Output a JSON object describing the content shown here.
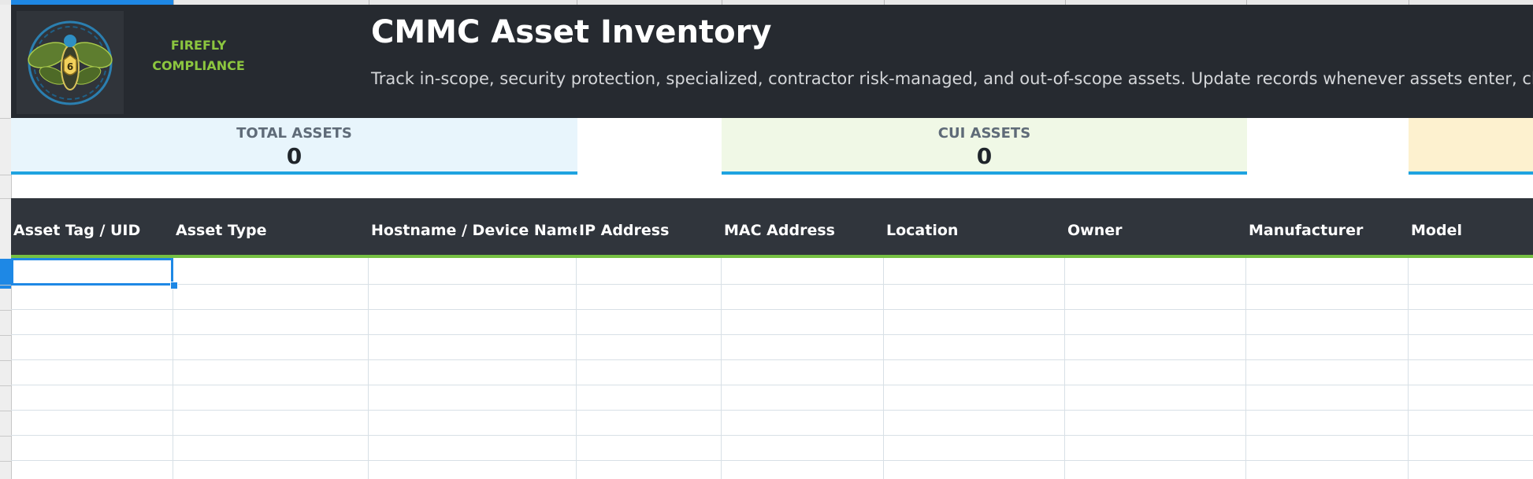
{
  "banner": {
    "brand_line1": "FIREFLY",
    "brand_line2": "COMPLIANCE",
    "title": "CMMC Asset Inventory",
    "subtitle": "Track in-scope, security protection, specialized, contractor risk-managed, and out-of-scope assets. Update records whenever assets enter, chan",
    "logo_icon": "firefly-shield-logo"
  },
  "kpis": {
    "total": {
      "label": "TOTAL ASSETS",
      "value": "0"
    },
    "cui": {
      "label": "CUI ASSETS",
      "value": "0"
    }
  },
  "columns": {
    "c1": "Asset Tag / UID",
    "c2": "Asset Type",
    "c3": "Hostname / Device Name",
    "c4": "IP Address",
    "c5": "MAC Address",
    "c6": "Location",
    "c7": "Owner",
    "c8": "Manufacturer",
    "c9": "Model"
  },
  "colors": {
    "banner_bg": "#262a30",
    "brand_green": "#8cc63f",
    "kpi_accent": "#1ea3e0",
    "header_accent": "#76c043",
    "selection": "#1e88e5"
  }
}
